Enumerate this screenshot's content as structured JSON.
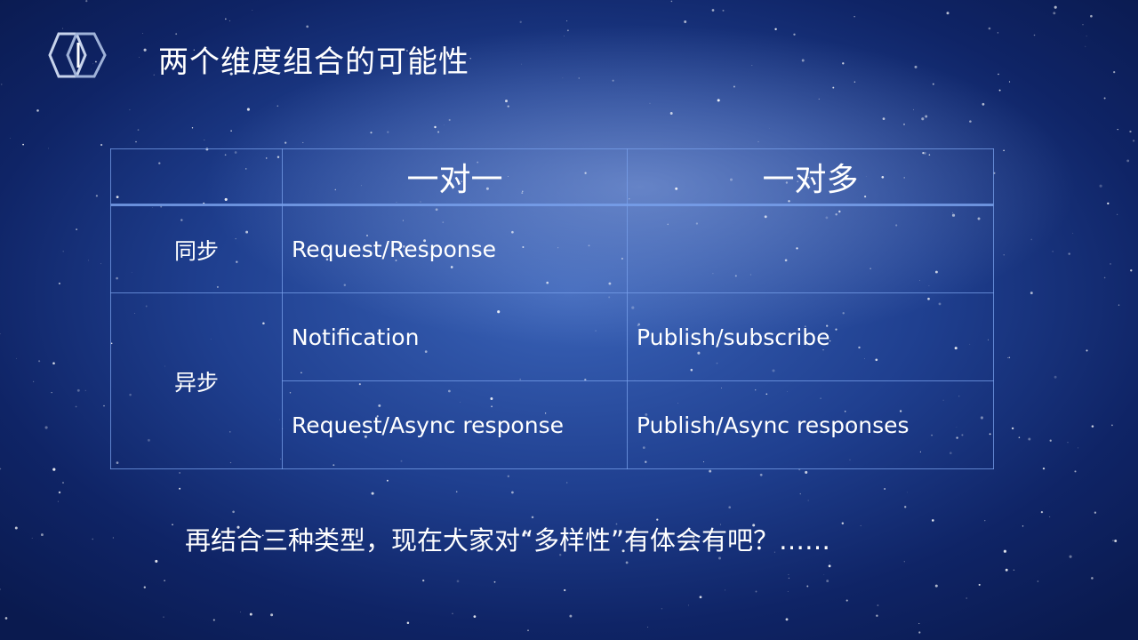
{
  "slide": {
    "title": "两个维度组合的可能性",
    "table": {
      "col_headers": [
        "",
        "一对一",
        "一对多"
      ],
      "rows": [
        {
          "label": "同步",
          "one_to_one": "Request/Response",
          "one_to_many": ""
        },
        {
          "label": "异步",
          "one_to_one": "Notification",
          "one_to_many": "Publish/subscribe"
        },
        {
          "label": "",
          "one_to_one": "Request/Async response",
          "one_to_many": "Publish/Async responses"
        }
      ]
    },
    "footer": "再结合三种类型，现在大家对“多样性”有体会有吧？……"
  },
  "colors": {
    "background_dark": "#0a1a4f",
    "background_mid": "#1f3f8f",
    "table_border": "#78a0eb",
    "text": "#ffffff"
  },
  "icons": {
    "logo": "hexagon-logo-icon"
  }
}
